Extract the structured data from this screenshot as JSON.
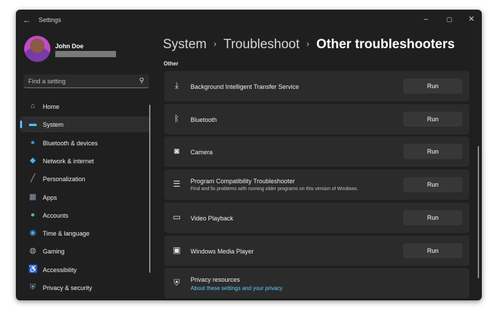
{
  "window": {
    "app_title": "Settings",
    "back_icon": "back-arrow-icon",
    "controls": {
      "minimize": "–",
      "maximize": "▢",
      "close": "✕"
    }
  },
  "user": {
    "name": "John Doe",
    "email_redacted": true
  },
  "search": {
    "placeholder": "Find a setting",
    "icon": "search-icon"
  },
  "sidebar": {
    "items": [
      {
        "label": "Home",
        "icon": "home-icon",
        "glyph": "⌂",
        "color": "#f0a35e",
        "active": false
      },
      {
        "label": "System",
        "icon": "system-icon",
        "glyph": "▬",
        "color": "#4cc2ff",
        "active": true
      },
      {
        "label": "Bluetooth & devices",
        "icon": "bluetooth-devices-icon",
        "glyph": "●",
        "color": "#3a8fe8",
        "active": false
      },
      {
        "label": "Network & internet",
        "icon": "network-icon",
        "glyph": "◆",
        "color": "#4fb1f0",
        "active": false
      },
      {
        "label": "Personalization",
        "icon": "brush-icon",
        "glyph": "╱",
        "color": "#e8a06a",
        "active": false
      },
      {
        "label": "Apps",
        "icon": "apps-icon",
        "glyph": "▦",
        "color": "#8fa3bf",
        "active": false
      },
      {
        "label": "Accounts",
        "icon": "accounts-icon",
        "glyph": "●",
        "color": "#3fc29a",
        "active": false
      },
      {
        "label": "Time & language",
        "icon": "globe-clock-icon",
        "glyph": "◉",
        "color": "#4aa3e8",
        "active": false
      },
      {
        "label": "Gaming",
        "icon": "gamepad-icon",
        "glyph": "◍",
        "color": "#b5b5b5",
        "active": false
      },
      {
        "label": "Accessibility",
        "icon": "accessibility-icon",
        "glyph": "♿",
        "color": "#3a8fe8",
        "active": false
      },
      {
        "label": "Privacy & security",
        "icon": "shield-icon",
        "glyph": "⛨",
        "color": "#9ab0c8",
        "active": false
      }
    ]
  },
  "breadcrumb": {
    "part1": "System",
    "part2": "Troubleshoot",
    "current": "Other troubleshooters",
    "separator": "›"
  },
  "section_label": "Other",
  "troubleshooters": [
    {
      "title": "Background Intelligent Transfer Service",
      "desc": "",
      "icon": "download-icon",
      "glyph": "⤓",
      "button": "Run"
    },
    {
      "title": "Bluetooth",
      "desc": "",
      "icon": "bluetooth-icon",
      "glyph": "ᛒ",
      "button": "Run"
    },
    {
      "title": "Camera",
      "desc": "",
      "icon": "camera-icon",
      "glyph": "◙",
      "button": "Run"
    },
    {
      "title": "Program Compatibility Troubleshooter",
      "desc": "Find and fix problems with running older programs on this version of Windows.",
      "icon": "list-icon",
      "glyph": "☰",
      "button": "Run"
    },
    {
      "title": "Video Playback",
      "desc": "",
      "icon": "video-icon",
      "glyph": "▭",
      "button": "Run"
    },
    {
      "title": "Windows Media Player",
      "desc": "",
      "icon": "media-player-icon",
      "glyph": "▣",
      "button": "Run"
    }
  ],
  "privacy_resources": {
    "title": "Privacy resources",
    "link": "About these settings and your privacy",
    "icon": "shield-icon",
    "glyph": "⛨"
  },
  "colors": {
    "accent": "#4cc2ff",
    "link": "#60cdff",
    "window_bg": "#1f1f1f",
    "card_bg": "#2b2b2b"
  }
}
